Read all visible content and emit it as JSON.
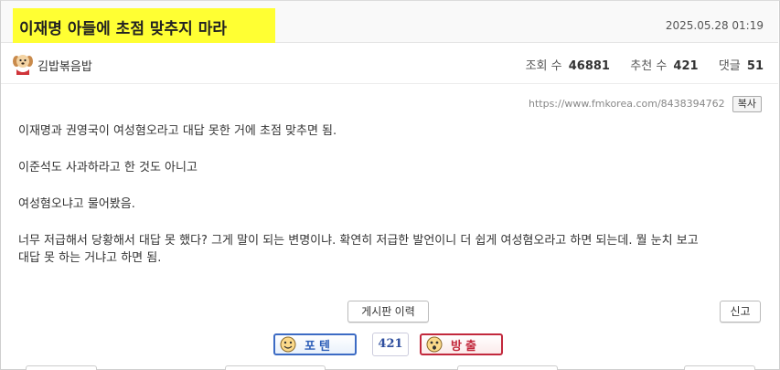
{
  "post": {
    "title": "이재명 아들에 초점 맞추지 마라",
    "date": "2025.05.28 01:19",
    "author": "김밥볶음밥",
    "stats": {
      "views_label": "조회 수",
      "views": "46881",
      "recommend_label": "추천 수",
      "recommend": "421",
      "comments_label": "댓글",
      "comments": "51"
    },
    "url": "https://www.fmkorea.com/8438394762",
    "copy_label": "복사",
    "body": [
      "이재명과 권영국이 여성혐오라고 대답 못한 거에 초점 맞추면 됨.",
      "이준석도 사과하라고 한 것도 아니고",
      "여성혐오냐고 물어봤음.",
      "너무 저급해서 당황해서 대답 못 했다? 그게 말이 되는 변명이냐. 확연히 저급한 발언이니 더 쉽게 여성혐오라고 하면 되는데. 뭘 눈치 보고",
      "대답 못 하는 거냐고 하면 됨."
    ]
  },
  "actions": {
    "history_label": "게시판 이력",
    "report_label": "신고",
    "upvote_label": "포텐",
    "vote_count": "421",
    "downvote_label": "방출"
  },
  "colors": {
    "title_highlight": "#ffff33",
    "upvote": "#3c6bc4",
    "downvote": "#c2283c"
  },
  "icons": {
    "avatar": "puppy-avatar-icon",
    "upvote": "happy-face-icon",
    "downvote": "shocked-face-icon"
  }
}
